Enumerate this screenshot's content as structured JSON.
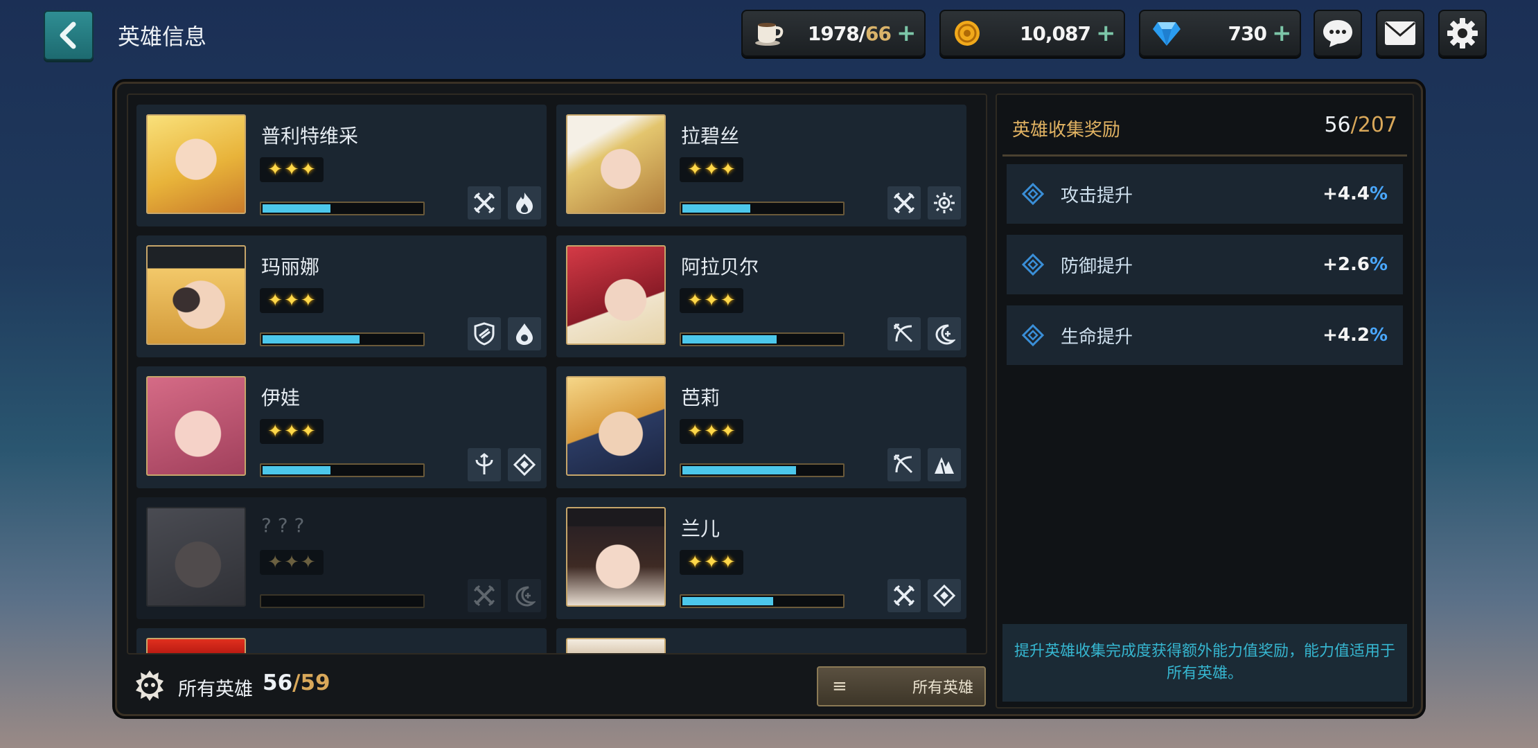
{
  "header": {
    "title": "英雄信息"
  },
  "resources": {
    "stamina": {
      "value": "1978",
      "max": "66"
    },
    "gold": {
      "value": "10,087"
    },
    "gems": {
      "value": "730"
    }
  },
  "heroes": [
    {
      "name": "普利特维采",
      "progress": 0.42,
      "tags": [
        "swords-icon",
        "fire-icon"
      ]
    },
    {
      "name": "拉碧丝",
      "progress": 0.42,
      "tags": [
        "swords-icon",
        "sun-icon"
      ]
    },
    {
      "name": "玛丽娜",
      "progress": 0.6,
      "tags": [
        "shield-icon",
        "water-icon"
      ]
    },
    {
      "name": "阿拉贝尔",
      "progress": 0.58,
      "tags": [
        "bow-icon",
        "moon-icon"
      ]
    },
    {
      "name": "伊娃",
      "progress": 0.42,
      "tags": [
        "staff-icon",
        "diamond-icon"
      ]
    },
    {
      "name": "芭莉",
      "progress": 0.7,
      "tags": [
        "bow-icon",
        "mountain-icon"
      ]
    },
    {
      "name": "? ? ?",
      "progress": 0.0,
      "tags": [
        "swords-icon",
        "moon-icon"
      ],
      "locked": true
    },
    {
      "name": "兰儿",
      "progress": 0.56,
      "tags": [
        "swords-icon",
        "diamond-icon"
      ]
    }
  ],
  "bonus": {
    "title": "英雄收集奖励",
    "count": "56",
    "total": "/207",
    "stats": [
      {
        "label": "攻击提升",
        "value": "+4.4",
        "unit": "%"
      },
      {
        "label": "防御提升",
        "value": "+2.6",
        "unit": "%"
      },
      {
        "label": "生命提升",
        "value": "+4.2",
        "unit": "%"
      }
    ],
    "note": "提升英雄收集完成度获得额外能力值奖励，能力值适用于所有英雄。"
  },
  "footer": {
    "label": "所有英雄",
    "count": "56",
    "total": "/59",
    "filter_label": "所有英雄"
  },
  "colors": {
    "accent": "#4cc7ea",
    "gold": "#d9a85a",
    "teal": "#2f8e93"
  }
}
